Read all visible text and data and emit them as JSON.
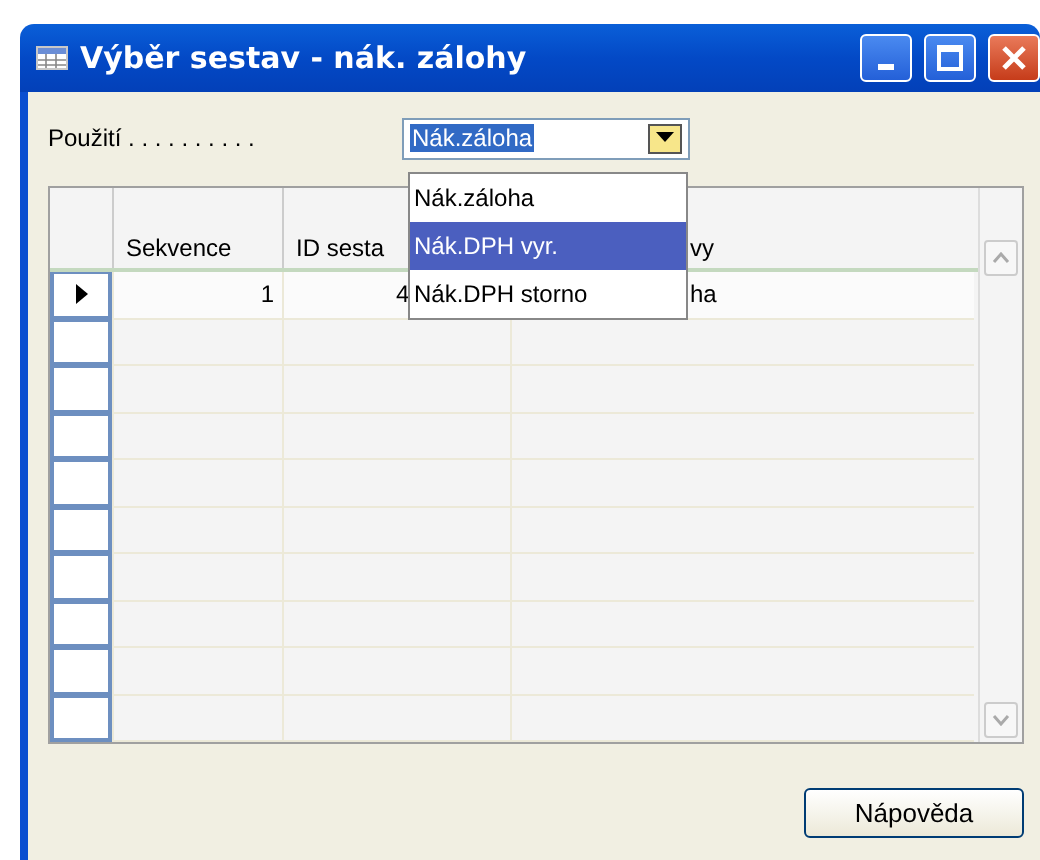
{
  "window": {
    "title": "Výběr sestav - nák. zálohy"
  },
  "usage_field": {
    "label": "Použití . . . . . . . . . .",
    "value": "Nák.záloha"
  },
  "dropdown": {
    "options": [
      {
        "label": "Nák.záloha",
        "selected": false
      },
      {
        "label": "Nák.DPH vyr.",
        "selected": true
      },
      {
        "label": "Nák.DPH storno",
        "selected": false
      }
    ]
  },
  "table": {
    "columns": [
      "Sekvence",
      "ID sesta",
      "vy"
    ],
    "rows": [
      {
        "current": true,
        "cells": [
          "1",
          "4",
          "ha"
        ]
      },
      {
        "current": false
      },
      {
        "current": false
      },
      {
        "current": false
      },
      {
        "current": false
      },
      {
        "current": false
      },
      {
        "current": false
      },
      {
        "current": false
      },
      {
        "current": false
      },
      {
        "current": false
      }
    ]
  },
  "buttons": [
    {
      "label": "Nápověda"
    }
  ]
}
